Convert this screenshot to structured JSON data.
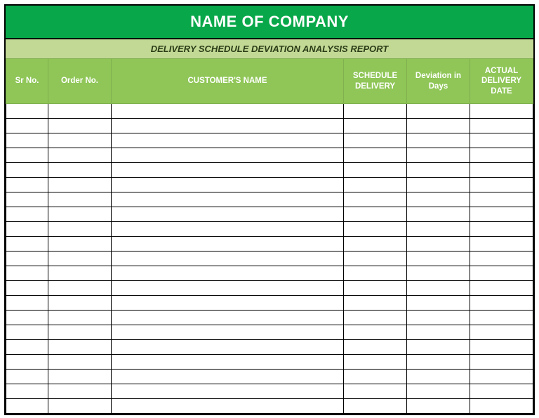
{
  "report": {
    "company_name": "NAME OF COMPANY",
    "subtitle": "DELIVERY SCHEDULE DEVIATION ANALYSIS REPORT",
    "columns": [
      "Sr No.",
      "Order No.",
      "CUSTOMER'S NAME",
      "SCHEDULE DELIVERY",
      "Deviation in Days",
      "ACTUAL DELIVERY DATE"
    ],
    "rows": [
      {
        "sr": "",
        "order": "",
        "customer": "",
        "schedule": "",
        "deviation": "",
        "actual": ""
      },
      {
        "sr": "",
        "order": "",
        "customer": "",
        "schedule": "",
        "deviation": "",
        "actual": ""
      },
      {
        "sr": "",
        "order": "",
        "customer": "",
        "schedule": "",
        "deviation": "",
        "actual": ""
      },
      {
        "sr": "",
        "order": "",
        "customer": "",
        "schedule": "",
        "deviation": "",
        "actual": ""
      },
      {
        "sr": "",
        "order": "",
        "customer": "",
        "schedule": "",
        "deviation": "",
        "actual": ""
      },
      {
        "sr": "",
        "order": "",
        "customer": "",
        "schedule": "",
        "deviation": "",
        "actual": ""
      },
      {
        "sr": "",
        "order": "",
        "customer": "",
        "schedule": "",
        "deviation": "",
        "actual": ""
      },
      {
        "sr": "",
        "order": "",
        "customer": "",
        "schedule": "",
        "deviation": "",
        "actual": ""
      },
      {
        "sr": "",
        "order": "",
        "customer": "",
        "schedule": "",
        "deviation": "",
        "actual": ""
      },
      {
        "sr": "",
        "order": "",
        "customer": "",
        "schedule": "",
        "deviation": "",
        "actual": ""
      },
      {
        "sr": "",
        "order": "",
        "customer": "",
        "schedule": "",
        "deviation": "",
        "actual": ""
      },
      {
        "sr": "",
        "order": "",
        "customer": "",
        "schedule": "",
        "deviation": "",
        "actual": ""
      },
      {
        "sr": "",
        "order": "",
        "customer": "",
        "schedule": "",
        "deviation": "",
        "actual": ""
      },
      {
        "sr": "",
        "order": "",
        "customer": "",
        "schedule": "",
        "deviation": "",
        "actual": ""
      },
      {
        "sr": "",
        "order": "",
        "customer": "",
        "schedule": "",
        "deviation": "",
        "actual": ""
      },
      {
        "sr": "",
        "order": "",
        "customer": "",
        "schedule": "",
        "deviation": "",
        "actual": ""
      },
      {
        "sr": "",
        "order": "",
        "customer": "",
        "schedule": "",
        "deviation": "",
        "actual": ""
      },
      {
        "sr": "",
        "order": "",
        "customer": "",
        "schedule": "",
        "deviation": "",
        "actual": ""
      },
      {
        "sr": "",
        "order": "",
        "customer": "",
        "schedule": "",
        "deviation": "",
        "actual": ""
      },
      {
        "sr": "",
        "order": "",
        "customer": "",
        "schedule": "",
        "deviation": "",
        "actual": ""
      },
      {
        "sr": "",
        "order": "",
        "customer": "",
        "schedule": "",
        "deviation": "",
        "actual": ""
      }
    ]
  }
}
